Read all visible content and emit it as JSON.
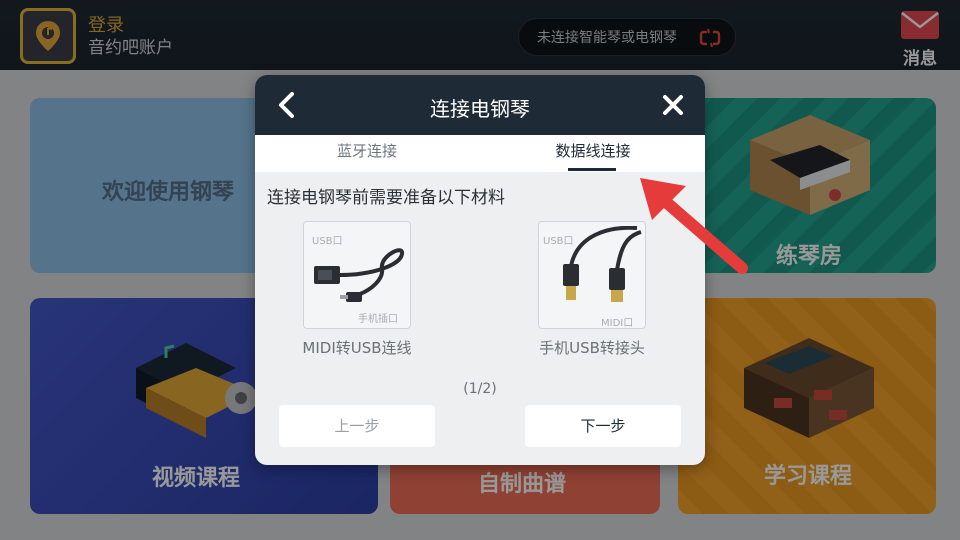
{
  "header": {
    "login_label": "登录",
    "account_label": "音约吧账户",
    "connection_status": "未连接智能琴或电钢琴",
    "messages_label": "消息"
  },
  "tiles": {
    "welcome": "欢迎使用钢琴",
    "practice_room": "练琴房",
    "video_course": "视频课程",
    "custom_score": "自制曲谱",
    "study_course": "学习课程"
  },
  "dialog": {
    "title": "连接电钢琴",
    "tabs": [
      "蓝牙连接",
      "数据线连接"
    ],
    "active_tab": "数据线连接",
    "intro": "连接电钢琴前需要准备以下材料",
    "items": [
      {
        "caption": "MIDI转USB连线",
        "label_top": "USB口",
        "label_bottom": "手机插口"
      },
      {
        "caption": "手机USB转接头",
        "label_top": "USB口",
        "label_bottom": "MIDI口"
      }
    ],
    "page_indicator": "(1/2)",
    "prev_button": "上一步",
    "next_button": "下一步"
  },
  "colors": {
    "topbar": "#1e2933",
    "accent_gold": "#e3b53a",
    "dialog_header": "#1e2a35",
    "annotation_arrow": "#e63b3b"
  }
}
